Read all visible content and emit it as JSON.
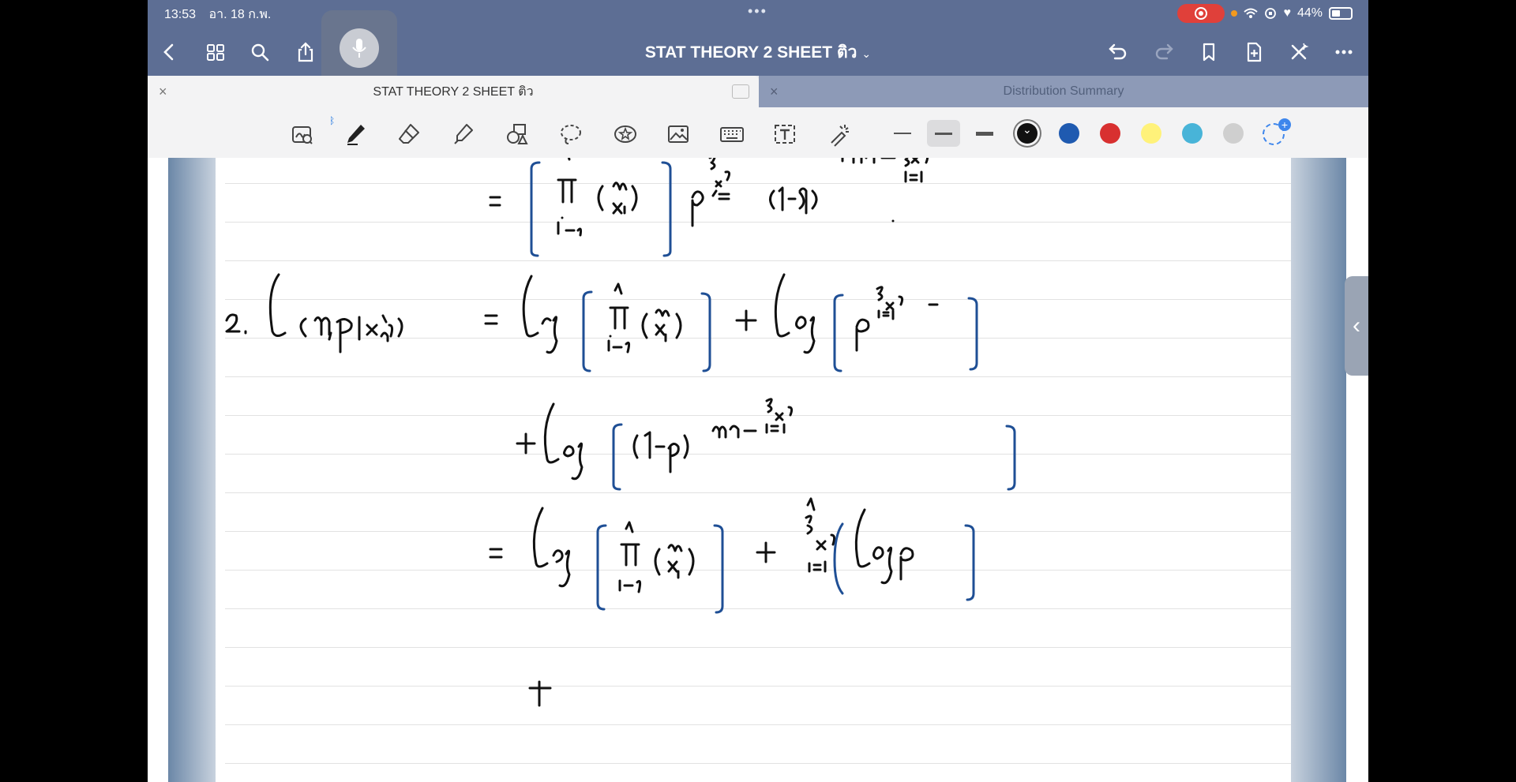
{
  "status_bar": {
    "time": "13:53",
    "date": "อา. 18 ก.พ.",
    "battery": "44%",
    "center_dots": "•••"
  },
  "nav": {
    "title": "STAT THEORY 2 SHEET ติว",
    "icons": [
      "back-icon",
      "grid-icon",
      "search-icon",
      "share-icon",
      "mic-icon",
      "undo-icon",
      "redo-icon",
      "bookmark-icon",
      "add-page-icon",
      "close-ai-icon",
      "more-icon"
    ]
  },
  "tabs": [
    {
      "label": "STAT THEORY 2 SHEET ติว",
      "close": "×"
    },
    {
      "label": "Distribution Summary",
      "close": "×"
    }
  ],
  "toolbar": {
    "tools": [
      "zoom-window",
      "pen",
      "eraser",
      "highlighter",
      "shapes",
      "lasso",
      "sticker",
      "image",
      "keyboard",
      "text",
      "laser-pointer"
    ],
    "selected_tool": "pen",
    "stroke_widths": [
      "thin",
      "medium",
      "thick"
    ],
    "selected_stroke": "medium",
    "colors": [
      "#111111",
      "#1f5ab0",
      "#d83030",
      "#fff27a",
      "#48b4d8",
      "#cfcfcf"
    ],
    "selected_color": "#111111"
  },
  "colors": {
    "nav_bg": "#5d6e94",
    "ink_black": "#111111",
    "ink_blue": "#1f4f95"
  }
}
